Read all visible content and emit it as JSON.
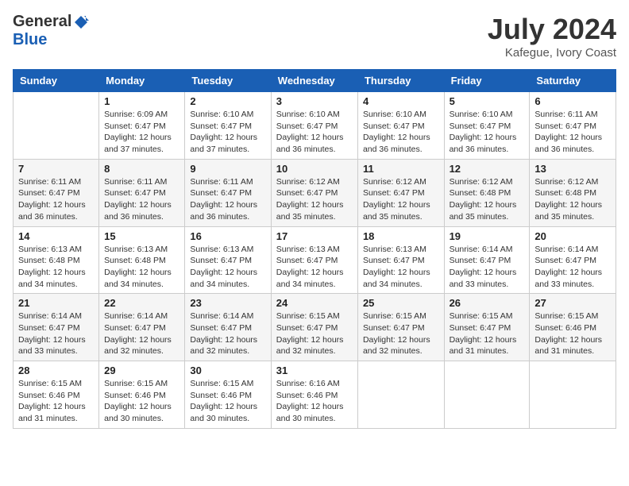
{
  "header": {
    "logo_general": "General",
    "logo_blue": "Blue",
    "title": "July 2024",
    "location": "Kafegue, Ivory Coast"
  },
  "days_of_week": [
    "Sunday",
    "Monday",
    "Tuesday",
    "Wednesday",
    "Thursday",
    "Friday",
    "Saturday"
  ],
  "weeks": [
    [
      {
        "day": "",
        "info": ""
      },
      {
        "day": "1",
        "info": "Sunrise: 6:09 AM\nSunset: 6:47 PM\nDaylight: 12 hours\nand 37 minutes."
      },
      {
        "day": "2",
        "info": "Sunrise: 6:10 AM\nSunset: 6:47 PM\nDaylight: 12 hours\nand 37 minutes."
      },
      {
        "day": "3",
        "info": "Sunrise: 6:10 AM\nSunset: 6:47 PM\nDaylight: 12 hours\nand 36 minutes."
      },
      {
        "day": "4",
        "info": "Sunrise: 6:10 AM\nSunset: 6:47 PM\nDaylight: 12 hours\nand 36 minutes."
      },
      {
        "day": "5",
        "info": "Sunrise: 6:10 AM\nSunset: 6:47 PM\nDaylight: 12 hours\nand 36 minutes."
      },
      {
        "day": "6",
        "info": "Sunrise: 6:11 AM\nSunset: 6:47 PM\nDaylight: 12 hours\nand 36 minutes."
      }
    ],
    [
      {
        "day": "7",
        "info": ""
      },
      {
        "day": "8",
        "info": "Sunrise: 6:11 AM\nSunset: 6:47 PM\nDaylight: 12 hours\nand 36 minutes."
      },
      {
        "day": "9",
        "info": "Sunrise: 6:11 AM\nSunset: 6:47 PM\nDaylight: 12 hours\nand 36 minutes."
      },
      {
        "day": "10",
        "info": "Sunrise: 6:12 AM\nSunset: 6:47 PM\nDaylight: 12 hours\nand 35 minutes."
      },
      {
        "day": "11",
        "info": "Sunrise: 6:12 AM\nSunset: 6:47 PM\nDaylight: 12 hours\nand 35 minutes."
      },
      {
        "day": "12",
        "info": "Sunrise: 6:12 AM\nSunset: 6:48 PM\nDaylight: 12 hours\nand 35 minutes."
      },
      {
        "day": "13",
        "info": "Sunrise: 6:12 AM\nSunset: 6:48 PM\nDaylight: 12 hours\nand 35 minutes."
      }
    ],
    [
      {
        "day": "14",
        "info": ""
      },
      {
        "day": "15",
        "info": "Sunrise: 6:13 AM\nSunset: 6:48 PM\nDaylight: 12 hours\nand 34 minutes."
      },
      {
        "day": "16",
        "info": "Sunrise: 6:13 AM\nSunset: 6:47 PM\nDaylight: 12 hours\nand 34 minutes."
      },
      {
        "day": "17",
        "info": "Sunrise: 6:13 AM\nSunset: 6:47 PM\nDaylight: 12 hours\nand 34 minutes."
      },
      {
        "day": "18",
        "info": "Sunrise: 6:13 AM\nSunset: 6:47 PM\nDaylight: 12 hours\nand 34 minutes."
      },
      {
        "day": "19",
        "info": "Sunrise: 6:14 AM\nSunset: 6:47 PM\nDaylight: 12 hours\nand 33 minutes."
      },
      {
        "day": "20",
        "info": "Sunrise: 6:14 AM\nSunset: 6:47 PM\nDaylight: 12 hours\nand 33 minutes."
      }
    ],
    [
      {
        "day": "21",
        "info": ""
      },
      {
        "day": "22",
        "info": "Sunrise: 6:14 AM\nSunset: 6:47 PM\nDaylight: 12 hours\nand 32 minutes."
      },
      {
        "day": "23",
        "info": "Sunrise: 6:14 AM\nSunset: 6:47 PM\nDaylight: 12 hours\nand 32 minutes."
      },
      {
        "day": "24",
        "info": "Sunrise: 6:15 AM\nSunset: 6:47 PM\nDaylight: 12 hours\nand 32 minutes."
      },
      {
        "day": "25",
        "info": "Sunrise: 6:15 AM\nSunset: 6:47 PM\nDaylight: 12 hours\nand 32 minutes."
      },
      {
        "day": "26",
        "info": "Sunrise: 6:15 AM\nSunset: 6:47 PM\nDaylight: 12 hours\nand 31 minutes."
      },
      {
        "day": "27",
        "info": "Sunrise: 6:15 AM\nSunset: 6:46 PM\nDaylight: 12 hours\nand 31 minutes."
      }
    ],
    [
      {
        "day": "28",
        "info": "Sunrise: 6:15 AM\nSunset: 6:46 PM\nDaylight: 12 hours\nand 31 minutes."
      },
      {
        "day": "29",
        "info": "Sunrise: 6:15 AM\nSunset: 6:46 PM\nDaylight: 12 hours\nand 30 minutes."
      },
      {
        "day": "30",
        "info": "Sunrise: 6:15 AM\nSunset: 6:46 PM\nDaylight: 12 hours\nand 30 minutes."
      },
      {
        "day": "31",
        "info": "Sunrise: 6:16 AM\nSunset: 6:46 PM\nDaylight: 12 hours\nand 30 minutes."
      },
      {
        "day": "",
        "info": ""
      },
      {
        "day": "",
        "info": ""
      },
      {
        "day": "",
        "info": ""
      }
    ]
  ],
  "week2_day7_info": "Sunrise: 6:11 AM\nSunset: 6:47 PM\nDaylight: 12 hours\nand 36 minutes.",
  "week3_day14_info": "Sunrise: 6:13 AM\nSunset: 6:48 PM\nDaylight: 12 hours\nand 34 minutes.",
  "week4_day21_info": "Sunrise: 6:14 AM\nSunset: 6:47 PM\nDaylight: 12 hours\nand 33 minutes."
}
